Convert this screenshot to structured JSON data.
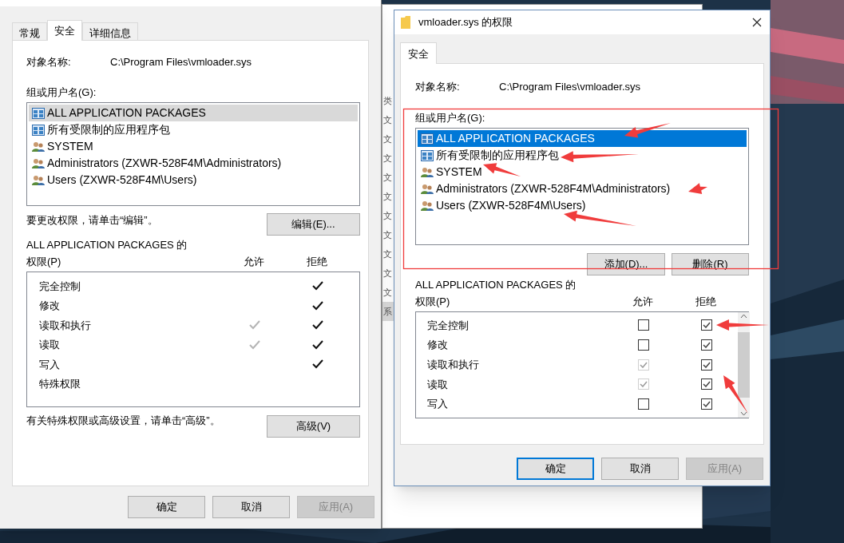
{
  "background_window": {
    "items": [
      {
        "text": "类",
        "selected": false
      },
      {
        "text": "文",
        "selected": false
      },
      {
        "text": "文",
        "selected": false
      },
      {
        "text": "文",
        "selected": false
      },
      {
        "text": "文",
        "selected": false
      },
      {
        "text": "文",
        "selected": false
      },
      {
        "text": "文",
        "selected": false
      },
      {
        "text": "文",
        "selected": false
      },
      {
        "text": "文",
        "selected": false
      },
      {
        "text": "文",
        "selected": false
      },
      {
        "text": "文",
        "selected": false
      },
      {
        "text": "系",
        "selected": true
      }
    ]
  },
  "properties_window": {
    "tabs": [
      {
        "label": "常规",
        "selected": false
      },
      {
        "label": "安全",
        "selected": true
      },
      {
        "label": "详细信息",
        "selected": false
      }
    ],
    "object_label": "对象名称:",
    "object_name": "C:\\Program Files\\vmloader.sys",
    "group_label": "组或用户名(G):",
    "principals": [
      {
        "name": "ALL APPLICATION PACKAGES",
        "kind": "package",
        "selected": true
      },
      {
        "name": "所有受限制的应用程序包",
        "kind": "package",
        "selected": false
      },
      {
        "name": "SYSTEM",
        "kind": "user",
        "selected": false
      },
      {
        "name": "Administrators (ZXWR-528F4M\\Administrators)",
        "kind": "user",
        "selected": false
      },
      {
        "name": "Users (ZXWR-528F4M\\Users)",
        "kind": "user",
        "selected": false
      }
    ],
    "edit_hint": "要更改权限，请单击“编辑”。",
    "edit_button": "编辑(E)...",
    "permissions_title": "ALL APPLICATION PACKAGES 的",
    "permissions_label": "权限(P)",
    "allow_header": "允许",
    "deny_header": "拒绝",
    "permissions": [
      {
        "name": "完全控制",
        "allow": false,
        "deny": true
      },
      {
        "name": "修改",
        "allow": false,
        "deny": true
      },
      {
        "name": "读取和执行",
        "allow": true,
        "allow_disabled": true,
        "deny": true
      },
      {
        "name": "读取",
        "allow": true,
        "allow_disabled": true,
        "deny": true
      },
      {
        "name": "写入",
        "allow": false,
        "deny": true
      },
      {
        "name": "特殊权限",
        "allow": false,
        "deny": false
      }
    ],
    "advanced_hint": "有关特殊权限或高级设置，请单击“高级”。",
    "advanced_button": "高级(V)",
    "buttons": [
      {
        "label": "确定",
        "default": false,
        "disabled": false
      },
      {
        "label": "取消",
        "default": false,
        "disabled": false
      },
      {
        "label": "应用(A)",
        "default": false,
        "disabled": true
      }
    ]
  },
  "permissions_dialog": {
    "title": "vmloader.sys 的权限",
    "tabs": [
      {
        "label": "安全",
        "selected": true
      }
    ],
    "object_label": "对象名称:",
    "object_name": "C:\\Program Files\\vmloader.sys",
    "group_label": "组或用户名(G):",
    "principals": [
      {
        "name": "ALL APPLICATION PACKAGES",
        "kind": "package",
        "selected": true
      },
      {
        "name": "所有受限制的应用程序包",
        "kind": "package",
        "selected": false
      },
      {
        "name": "SYSTEM",
        "kind": "user",
        "selected": false
      },
      {
        "name": "Administrators (ZXWR-528F4M\\Administrators)",
        "kind": "user",
        "selected": false
      },
      {
        "name": "Users (ZXWR-528F4M\\Users)",
        "kind": "user",
        "selected": false
      }
    ],
    "add_button": "添加(D)...",
    "remove_button": "删除(R)",
    "permissions_title": "ALL APPLICATION PACKAGES 的",
    "permissions_label": "权限(P)",
    "allow_header": "允许",
    "deny_header": "拒绝",
    "permissions": [
      {
        "name": "完全控制",
        "allow": false,
        "allow_disabled": false,
        "deny": true
      },
      {
        "name": "修改",
        "allow": false,
        "allow_disabled": false,
        "deny": true
      },
      {
        "name": "读取和执行",
        "allow": true,
        "allow_disabled": true,
        "deny": true
      },
      {
        "name": "读取",
        "allow": true,
        "allow_disabled": true,
        "deny": true
      },
      {
        "name": "写入",
        "allow": false,
        "allow_disabled": false,
        "deny": true
      }
    ],
    "buttons": [
      {
        "label": "确定",
        "default": true,
        "disabled": false
      },
      {
        "label": "取消",
        "default": false,
        "disabled": false
      },
      {
        "label": "应用(A)",
        "default": false,
        "disabled": true
      }
    ]
  }
}
